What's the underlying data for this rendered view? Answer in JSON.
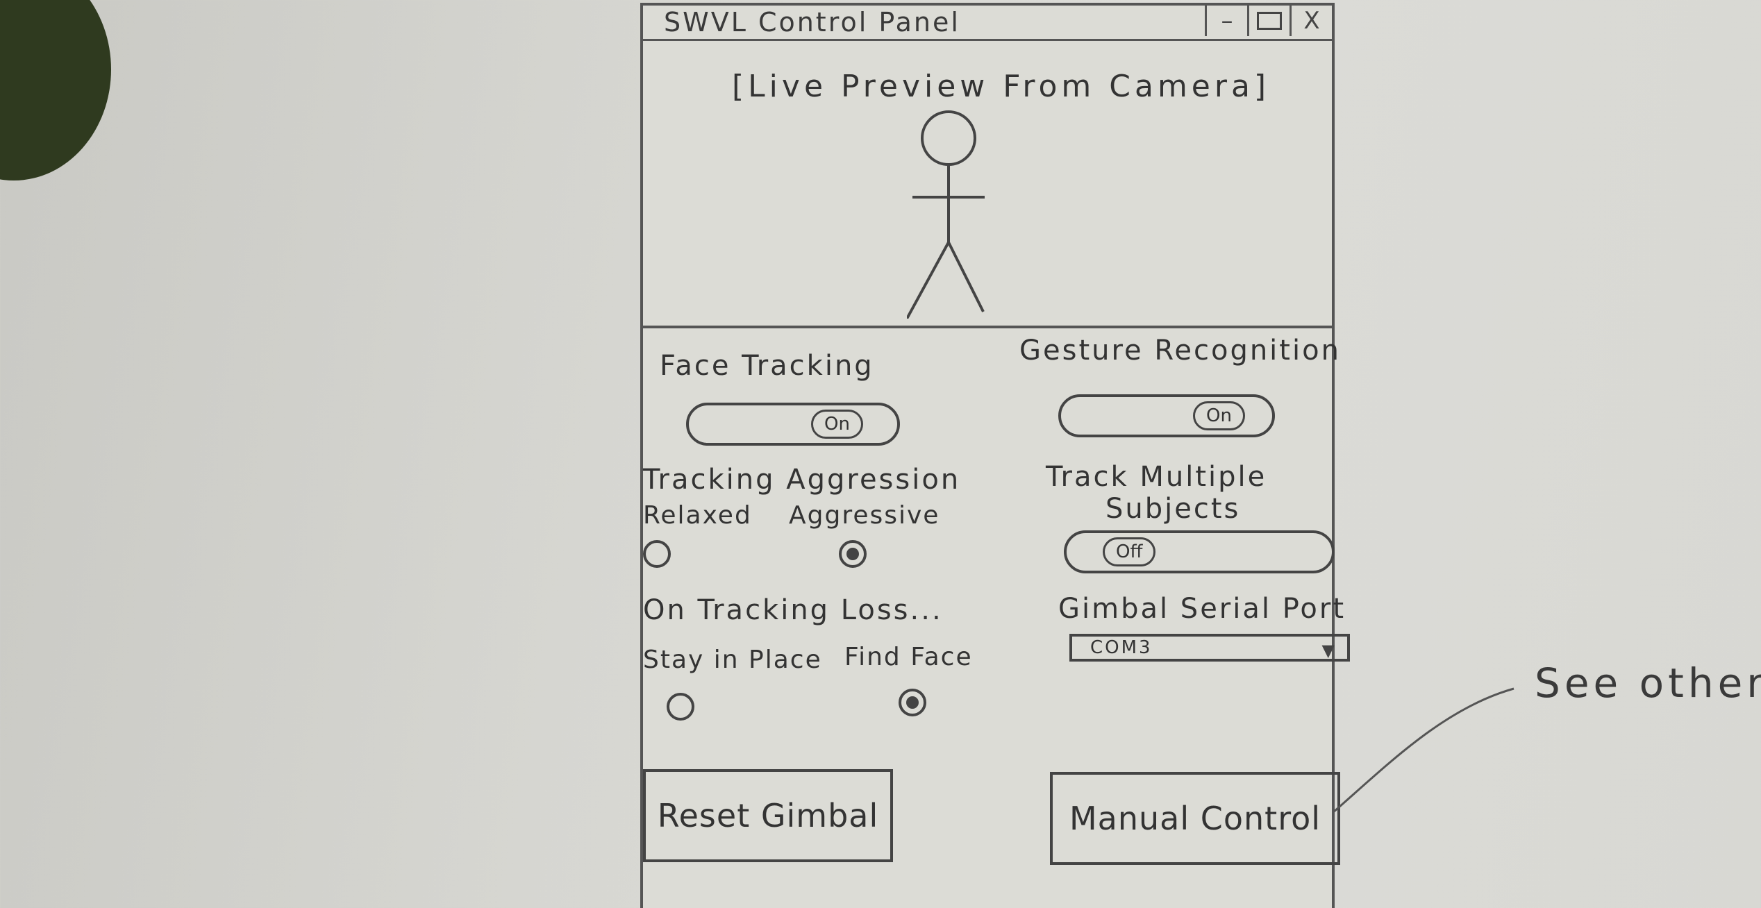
{
  "window": {
    "title": "SWVL Control Panel",
    "controls": {
      "minimize": "–",
      "close": "X"
    }
  },
  "preview": {
    "label": "[Live Preview From Camera]"
  },
  "face_tracking": {
    "label": "Face Tracking",
    "toggle_state": "On"
  },
  "gesture_recognition": {
    "label": "Gesture Recognition",
    "toggle_state": "On"
  },
  "tracking_aggression": {
    "label": "Tracking Aggression",
    "options": [
      "Relaxed",
      "Aggressive"
    ],
    "selected": "Aggressive"
  },
  "track_multiple": {
    "label_line1": "Track Multiple",
    "label_line2": "Subjects",
    "toggle_state": "Off"
  },
  "tracking_loss": {
    "label": "On Tracking Loss...",
    "options": [
      "Stay in Place",
      "Find Face"
    ],
    "selected": "Find Face"
  },
  "serial_port": {
    "label": "Gimbal Serial Port",
    "value": "COM3"
  },
  "buttons": {
    "reset": "Reset Gimbal",
    "manual": "Manual Control"
  },
  "annotation": {
    "text": "See other"
  }
}
